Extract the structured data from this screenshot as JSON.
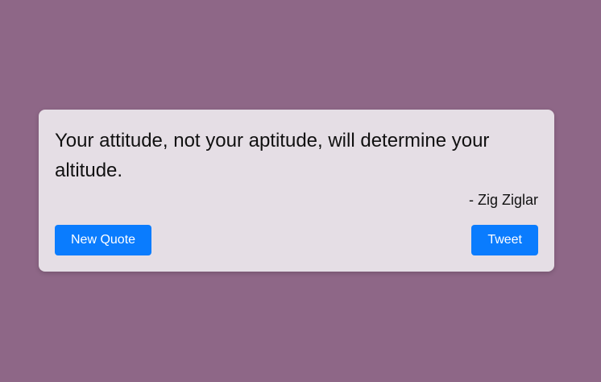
{
  "quote": {
    "text": "Your attitude, not your aptitude, will determine your altitude.",
    "author": "- Zig Ziglar"
  },
  "actions": {
    "new_quote_label": "New Quote",
    "tweet_label": "Tweet"
  },
  "colors": {
    "background": "#8e6787",
    "card": "#e5dee5",
    "button": "#0a7cfe",
    "button_text": "#ffffff",
    "text": "#111111"
  }
}
